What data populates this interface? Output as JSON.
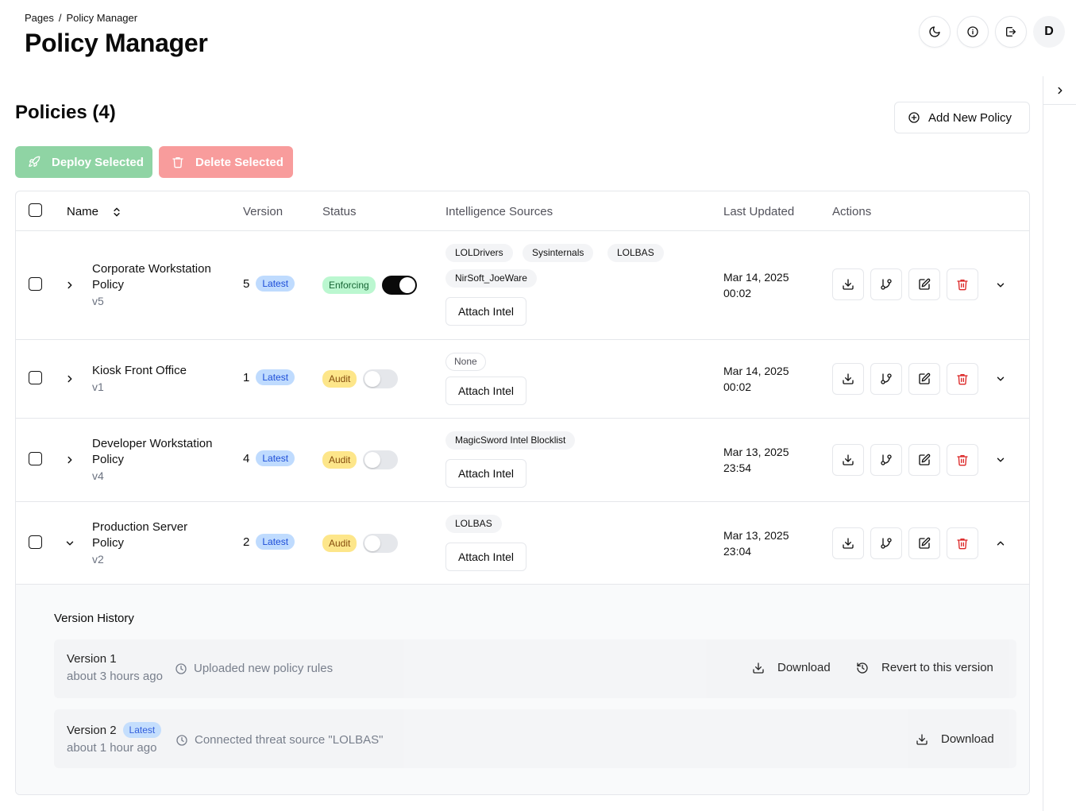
{
  "header": {
    "breadcrumb": {
      "root": "Pages",
      "separator": "/",
      "current": "Policy Manager"
    },
    "title": "Policy Manager",
    "avatar_initial": "D",
    "icons": [
      "moon-icon",
      "info-icon",
      "logout-icon"
    ]
  },
  "section": {
    "title": "Policies (4)",
    "add_label": "Add New Policy",
    "deploy_label": "Deploy Selected",
    "delete_label": "Delete Selected"
  },
  "table": {
    "columns": {
      "name": "Name",
      "version": "Version",
      "status": "Status",
      "sources": "Intelligence Sources",
      "updated": "Last Updated",
      "actions": "Actions"
    },
    "attach_label": "Attach Intel",
    "latest_label": "Latest",
    "rows": [
      {
        "name_line1": "Corporate Workstation",
        "name_line2": "Policy",
        "version_tag": "v5",
        "version": "5",
        "status": "Enforcing",
        "enabled": true,
        "sources": [
          "LOLDrivers",
          "Sysinternals",
          "LOLBAS",
          "NirSoft_JoeWare"
        ],
        "updated_date": "Mar 14, 2025",
        "updated_time": "00:02",
        "expanded": false
      },
      {
        "name_line1": "Kiosk Front Office",
        "name_line2": "",
        "version_tag": "v1",
        "version": "1",
        "status": "Audit",
        "enabled": false,
        "sources": [
          "None"
        ],
        "updated_date": "Mar 14, 2025",
        "updated_time": "00:02",
        "expanded": false
      },
      {
        "name_line1": "Developer Workstation",
        "name_line2": "Policy",
        "version_tag": "v4",
        "version": "4",
        "status": "Audit",
        "enabled": false,
        "sources": [
          "MagicSword Intel Blocklist"
        ],
        "updated_date": "Mar 13, 2025",
        "updated_time": "23:54",
        "expanded": false
      },
      {
        "name_line1": "Production Server",
        "name_line2": "Policy",
        "version_tag": "v2",
        "version": "2",
        "status": "Audit",
        "enabled": false,
        "sources": [
          "LOLBAS"
        ],
        "updated_date": "Mar 13, 2025",
        "updated_time": "23:04",
        "expanded": true
      }
    ]
  },
  "history": {
    "title": "Version History",
    "download_label": "Download",
    "revert_label": "Revert to this version",
    "versions": [
      {
        "name": "Version 1",
        "latest": false,
        "time": "about 3 hours ago",
        "description": "Uploaded new policy rules"
      },
      {
        "name": "Version 2",
        "latest": true,
        "time": "about 1 hour ago",
        "description": "Connected threat source \"LOLBAS\""
      }
    ]
  },
  "colors": {
    "deploy": "#8fd4a4",
    "delete": "#f89c9c",
    "latest_badge": "#bfdbfe",
    "enforcing_badge": "#bbf7d0",
    "audit_badge": "#fde68a",
    "danger_icon": "#dc2626"
  }
}
